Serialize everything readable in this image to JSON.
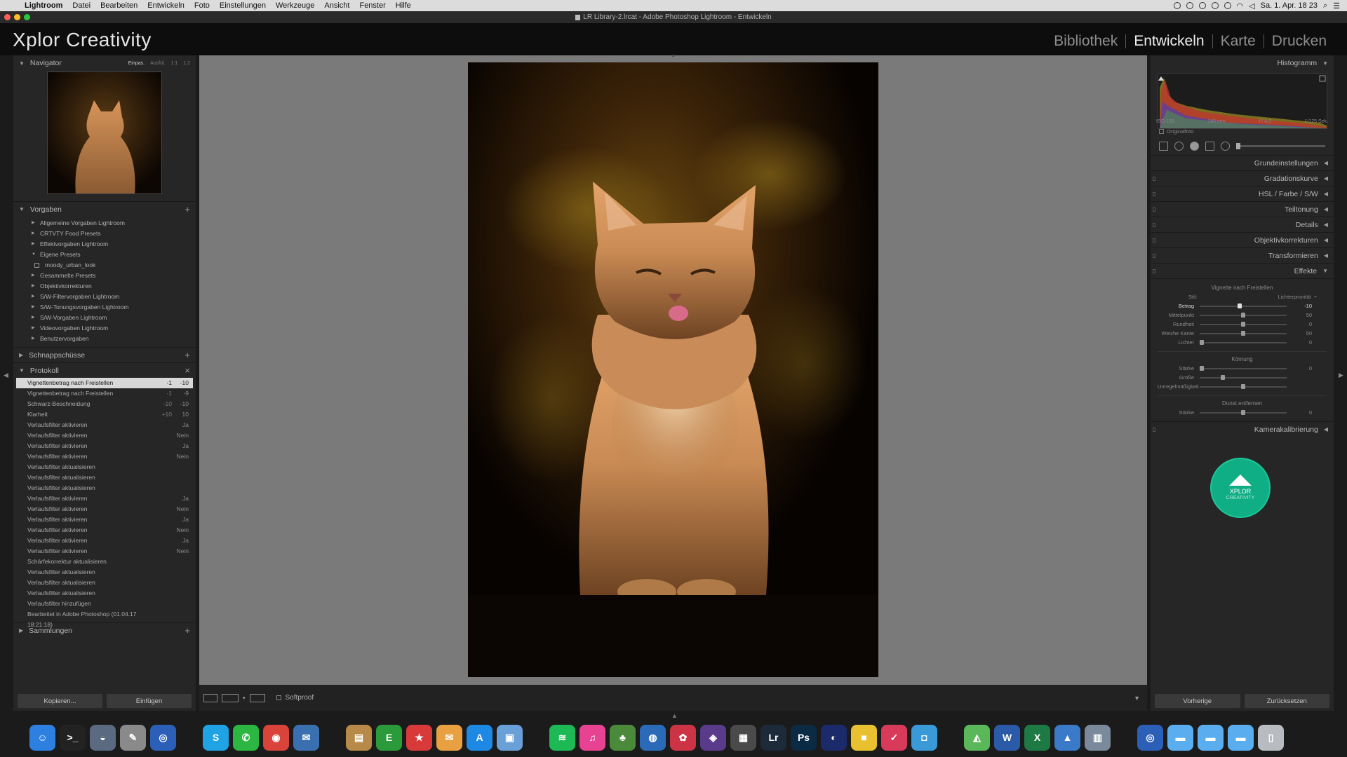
{
  "menubar": {
    "app": "Lightroom",
    "items": [
      "Datei",
      "Bearbeiten",
      "Entwickeln",
      "Foto",
      "Einstellungen",
      "Werkzeuge",
      "Ansicht",
      "Fenster",
      "Hilfe"
    ],
    "clock": "Sa. 1. Apr. 18 23"
  },
  "window": {
    "title": "LR Library-2.lrcat - Adobe Photoshop Lightroom - Entwickeln"
  },
  "identity": {
    "brand": "Xplor Creativity"
  },
  "modules": [
    {
      "label": "Bibliothek",
      "active": false
    },
    {
      "label": "Entwickeln",
      "active": true
    },
    {
      "label": "Karte",
      "active": false
    },
    {
      "label": "Drucken",
      "active": false
    }
  ],
  "navigator": {
    "title": "Navigator",
    "zoom": [
      "Einpas.",
      "Ausfül.",
      "1:1",
      "1:2"
    ]
  },
  "presets": {
    "title": "Vorgaben",
    "items": [
      {
        "label": "Allgemeine Vorgaben Lightroom",
        "expanded": false
      },
      {
        "label": "CRTVTY Food Presets",
        "expanded": false
      },
      {
        "label": "Effektvorgaben Lightroom",
        "expanded": false
      },
      {
        "label": "Eigene Presets",
        "expanded": true
      },
      {
        "label": "moody_urban_look",
        "child": true
      },
      {
        "label": "Gesammelte Presets",
        "expanded": false
      },
      {
        "label": "Objektivkorrekturen",
        "expanded": false
      },
      {
        "label": "S/W-Filtervorgaben Lightroom",
        "expanded": false
      },
      {
        "label": "S/W-Tonungsvorgaben Lightroom",
        "expanded": false
      },
      {
        "label": "S/W-Vorgaben Lightroom",
        "expanded": false
      },
      {
        "label": "Videovorgaben Lightroom",
        "expanded": false
      },
      {
        "label": "Benutzervorgaben",
        "expanded": false
      }
    ]
  },
  "snapshots": {
    "title": "Schnappschüsse"
  },
  "history": {
    "title": "Protokoll",
    "items": [
      {
        "label": "Vignettenbetrag nach Freistellen",
        "v1": "-1",
        "v2": "-10",
        "selected": true
      },
      {
        "label": "Vignettenbetrag nach Freistellen",
        "v1": "-1",
        "v2": "-9"
      },
      {
        "label": "Schwarz-Beschneidung",
        "v1": "-10",
        "v2": "-10"
      },
      {
        "label": "Klarheit",
        "v1": "+10",
        "v2": "10"
      },
      {
        "label": "Verlaufsfilter aktivieren",
        "v1": "",
        "v2": "Ja"
      },
      {
        "label": "Verlaufsfilter aktivieren",
        "v1": "",
        "v2": "Nein"
      },
      {
        "label": "Verlaufsfilter aktivieren",
        "v1": "",
        "v2": "Ja"
      },
      {
        "label": "Verlaufsfilter aktivieren",
        "v1": "",
        "v2": "Nein"
      },
      {
        "label": "Verlaufsfilter aktualisieren",
        "v1": "",
        "v2": ""
      },
      {
        "label": "Verlaufsfilter aktualisieren",
        "v1": "",
        "v2": ""
      },
      {
        "label": "Verlaufsfilter aktualisieren",
        "v1": "",
        "v2": ""
      },
      {
        "label": "Verlaufsfilter aktivieren",
        "v1": "",
        "v2": "Ja"
      },
      {
        "label": "Verlaufsfilter aktivieren",
        "v1": "",
        "v2": "Nein"
      },
      {
        "label": "Verlaufsfilter aktivieren",
        "v1": "",
        "v2": "Ja"
      },
      {
        "label": "Verlaufsfilter aktivieren",
        "v1": "",
        "v2": "Nein"
      },
      {
        "label": "Verlaufsfilter aktivieren",
        "v1": "",
        "v2": "Ja"
      },
      {
        "label": "Verlaufsfilter aktivieren",
        "v1": "",
        "v2": "Nein"
      },
      {
        "label": "Schärfekorrektur aktualisieren",
        "v1": "",
        "v2": ""
      },
      {
        "label": "Verlaufsfilter aktualisieren",
        "v1": "",
        "v2": ""
      },
      {
        "label": "Verlaufsfilter aktualisieren",
        "v1": "",
        "v2": ""
      },
      {
        "label": "Verlaufsfilter aktualisieren",
        "v1": "",
        "v2": ""
      },
      {
        "label": "Verlaufsfilter hinzufügen",
        "v1": "",
        "v2": ""
      },
      {
        "label": "Bearbeitet in Adobe Photoshop (01.04.17 18:21:18)",
        "v1": "",
        "v2": ""
      }
    ]
  },
  "collections": {
    "title": "Sammlungen"
  },
  "left_buttons": {
    "copy": "Kopieren...",
    "paste": "Einfügen"
  },
  "toolbar": {
    "softproof": "Softproof"
  },
  "histogram": {
    "title": "Histogramm",
    "info": [
      "ISO 100",
      "140 mm",
      "f / 4,0",
      "1/125 Sek."
    ],
    "original_photo": "Originalfoto"
  },
  "develop_panels": [
    {
      "label": "Grundeinstellungen"
    },
    {
      "label": "Gradationskurve"
    },
    {
      "label": "HSL / Farbe / S/W"
    },
    {
      "label": "Teiltonung"
    },
    {
      "label": "Details"
    },
    {
      "label": "Objektivkorrekturen"
    },
    {
      "label": "Transformieren"
    }
  ],
  "effects": {
    "title": "Effekte",
    "vignette_title": "Vignette nach Freistellen",
    "stil_label": "Stil:",
    "stil_value": "Lichterpriorität",
    "vignette_sliders": [
      {
        "label": "Betrag",
        "value": "-10",
        "pos": 0.46,
        "active": true
      },
      {
        "label": "Mittelpunkt",
        "value": "50",
        "pos": 0.5
      },
      {
        "label": "Rundheit",
        "value": "0",
        "pos": 0.5
      },
      {
        "label": "Weiche Kante",
        "value": "50",
        "pos": 0.5
      },
      {
        "label": "Lichter",
        "value": "0",
        "pos": 0.0
      }
    ],
    "grain_title": "Körnung",
    "grain_sliders": [
      {
        "label": "Stärke",
        "value": "0",
        "pos": 0.0
      },
      {
        "label": "Größe",
        "value": "",
        "pos": 0.25
      },
      {
        "label": "Unregelmäßigkeit",
        "value": "",
        "pos": 0.5
      }
    ],
    "dehaze_title": "Dunst entfernen",
    "dehaze_sliders": [
      {
        "label": "Stärke",
        "value": "0",
        "pos": 0.5
      }
    ]
  },
  "camera_calibration": {
    "label": "Kamerakalibrierung"
  },
  "logo": {
    "line1": "XPLOR",
    "line2": "CREATIVITY"
  },
  "right_buttons": {
    "previous": "Vorherige",
    "reset": "Zurücksetzen"
  },
  "dock": [
    {
      "name": "finder",
      "color": "#2d7fe0",
      "glyph": "☺"
    },
    {
      "name": "terminal",
      "color": "#222222",
      "glyph": ">_"
    },
    {
      "name": "launchpad",
      "color": "#5a6a80",
      "glyph": "◒"
    },
    {
      "name": "script",
      "color": "#8a8a8a",
      "glyph": "✎"
    },
    {
      "name": "onepassword",
      "color": "#2c5fb8",
      "glyph": "◎"
    },
    {
      "name": "gap"
    },
    {
      "name": "skype",
      "color": "#1fa3e4",
      "glyph": "S"
    },
    {
      "name": "whatsapp",
      "color": "#2bb741",
      "glyph": "✆"
    },
    {
      "name": "chrome",
      "color": "#d9433a",
      "glyph": "◉"
    },
    {
      "name": "thunderbird",
      "color": "#3a6fb0",
      "glyph": "✉"
    },
    {
      "name": "gap"
    },
    {
      "name": "notes",
      "color": "#b88a4a",
      "glyph": "▤"
    },
    {
      "name": "evernote",
      "color": "#2a9a3a",
      "glyph": "E"
    },
    {
      "name": "todo",
      "color": "#d83a3a",
      "glyph": "★"
    },
    {
      "name": "mail-stack",
      "color": "#e8a040",
      "glyph": "✉"
    },
    {
      "name": "appstore",
      "color": "#1e88e5",
      "glyph": "A"
    },
    {
      "name": "preview",
      "color": "#6aa0d8",
      "glyph": "▣"
    },
    {
      "name": "gap"
    },
    {
      "name": "spotify",
      "color": "#1db954",
      "glyph": "≋"
    },
    {
      "name": "itunes",
      "color": "#e84393",
      "glyph": "♫"
    },
    {
      "name": "game",
      "color": "#4a8a3a",
      "glyph": "♣"
    },
    {
      "name": "safari",
      "color": "#2a6ab8",
      "glyph": "◍"
    },
    {
      "name": "davinci",
      "color": "#cc3344",
      "glyph": "✿"
    },
    {
      "name": "motion",
      "color": "#5a3a8a",
      "glyph": "◈"
    },
    {
      "name": "photo-app",
      "color": "#4a4a4a",
      "glyph": "▦"
    },
    {
      "name": "lightroom",
      "color": "#1c2a3a",
      "glyph": "Lr"
    },
    {
      "name": "photoshop",
      "color": "#0b2a44",
      "glyph": "Ps"
    },
    {
      "name": "aurora",
      "color": "#1a2a6a",
      "glyph": "◐"
    },
    {
      "name": "colors",
      "color": "#e8c030",
      "glyph": "■"
    },
    {
      "name": "cursor-app",
      "color": "#d83a5a",
      "glyph": "✓"
    },
    {
      "name": "screenshot",
      "color": "#3a9ad8",
      "glyph": "◘"
    },
    {
      "name": "gap"
    },
    {
      "name": "maps",
      "color": "#5ab85a",
      "glyph": "◭"
    },
    {
      "name": "word",
      "color": "#2a5aa8",
      "glyph": "W"
    },
    {
      "name": "excel",
      "color": "#1e7a45",
      "glyph": "X"
    },
    {
      "name": "keynote",
      "color": "#3a7ac8",
      "glyph": "▲"
    },
    {
      "name": "files",
      "color": "#7a8a9a",
      "glyph": "▥"
    },
    {
      "name": "gap"
    },
    {
      "name": "onepassword-2",
      "color": "#2c5fb8",
      "glyph": "◎"
    },
    {
      "name": "folder-1",
      "color": "#5aaef0",
      "glyph": "▬"
    },
    {
      "name": "folder-2",
      "color": "#5aaef0",
      "glyph": "▬"
    },
    {
      "name": "folder-3",
      "color": "#5aaef0",
      "glyph": "▬"
    },
    {
      "name": "trash",
      "color": "#b8bcc0",
      "glyph": "▯"
    }
  ]
}
